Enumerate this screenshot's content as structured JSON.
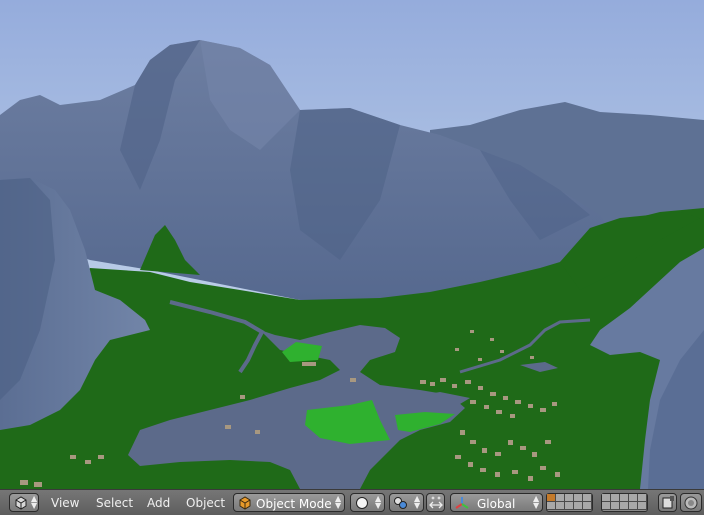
{
  "header": {
    "editor_type_icon": "cube-view-icon",
    "menus": {
      "view": "View",
      "select": "Select",
      "add": "Add",
      "object": "Object"
    },
    "mode": {
      "label": "Object Mode",
      "icon": "orange-cube-icon"
    },
    "shading_icon": "sphere-shading-icon",
    "pivot_icon": "pivot-point-icon",
    "manipulator_icon": "manipulator-icon",
    "orientation": {
      "label": "Global",
      "icon": "transform-axes-icon"
    },
    "layers_icon": "layer-grid",
    "lock_icon": "lock-camera-icon",
    "render_icon": "render-preview-icon"
  },
  "colors": {
    "sky_top": "#9fb6e3",
    "sky_bottom": "#cfe0f0",
    "mountain": "#5f7397",
    "grass": "#1f6a18",
    "bright_grass": "#2fb12f",
    "water": "#5c6a8a",
    "header_bg": "#6e6e6e"
  }
}
